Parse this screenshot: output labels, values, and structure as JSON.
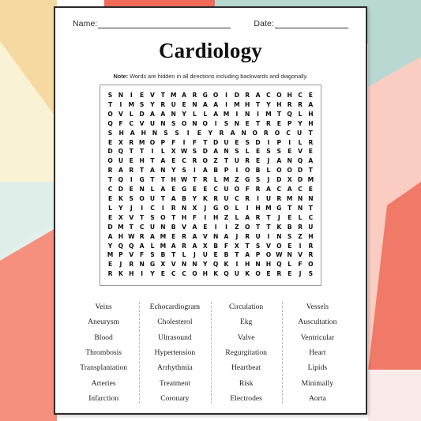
{
  "header": {
    "name_label": "Name:",
    "date_label": "Date:"
  },
  "title": "Cardiology",
  "note": {
    "prefix": "Note:",
    "text": " Words are hidden in all directions including backwards and diagonally."
  },
  "grid": {
    "rows": 20,
    "cols": 20,
    "letters": [
      "SNIEVTMARGOIDRACOHCE",
      "TIMSYRUENAAIMHTYHRRA",
      "OVLDAANYLLAMINIMTQLH",
      "QFCVUNSONOISNETREPYH",
      "SHAHNSSIEYRANOROCUT",
      "EXRMOPFIFTDUESDIPILR",
      "DQTTILXWSDANSLESSEVE",
      "OUEHTAECROZTUREJANQA",
      "RARTANYSIABPIOBLOODT",
      "TQIGTTHWTRLMZGSJDXDM",
      "CDENLAEGEECUOFRACACE",
      "EKSOUTABYKRUCRIURMNN",
      "LYJICIRNXJGOLIHMGTNT",
      "EXVTSOTHFIHZLARTJELC",
      "DMTCUNBVAEIIZOTTKBRU",
      "AHWRAMERAVNAJRUINSZH",
      "YQQALMARAXBFXTSVOEIR",
      "MPVFSBTLJUEBTAPOWNVR",
      "EJRNGXVNNYQKIHNHQLFO",
      "RKHIYECCOHKQUKOEREJS"
    ]
  },
  "word_list": {
    "columns": [
      [
        "Veins",
        "Aneurysm",
        "Blood",
        "Thrombosis",
        "Transplantation",
        "Arteries",
        "Infarction"
      ],
      [
        "Echocardiogram",
        "Cholesterol",
        "Ultrasound",
        "Hypertension",
        "Arrhythmia",
        "Treatment",
        "Coronary"
      ],
      [
        "Circulation",
        "Ekg",
        "Valve",
        "Regurgitation",
        "Heartbeat",
        "Risk",
        "Electrodes"
      ],
      [
        "Vessels",
        "Auscultation",
        "Ventricular",
        "Heart",
        "Lipids",
        "Minimally",
        "Aorta"
      ]
    ]
  },
  "background": {
    "amber": "#f6d9a0",
    "cream": "#faf2d4",
    "teal": "#d9ebe6",
    "teal_deep": "#b5d6d0",
    "coral": "#f37c6a",
    "salmon": "#f5907e",
    "pink_light": "#fbcdc2",
    "pink_pale": "#faeaea",
    "white": "#ffffff"
  }
}
